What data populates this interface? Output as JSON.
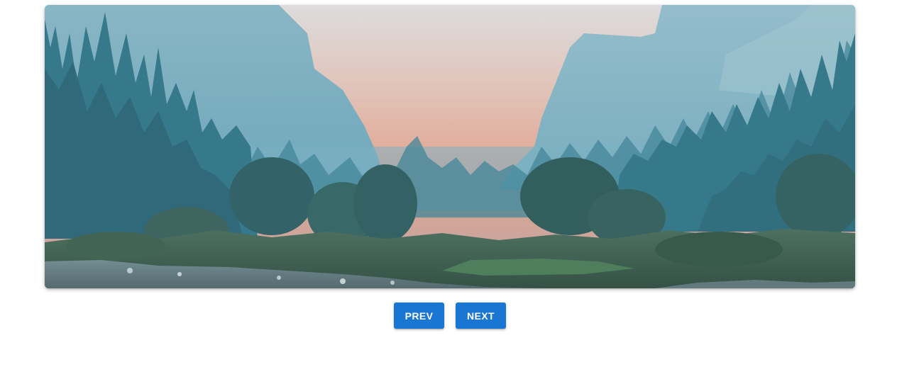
{
  "carousel": {
    "slide_image": "forest-valley-landscape",
    "colors": {
      "sky_glow": "#f4a98f",
      "sky_top": "#efe6e4",
      "mist": "#7fb6c7",
      "forest": "#2e6f80",
      "foreground": "#3d5a46"
    }
  },
  "controls": {
    "prev_label": "PREV",
    "next_label": "NEXT",
    "button_color": "#1976d2"
  }
}
